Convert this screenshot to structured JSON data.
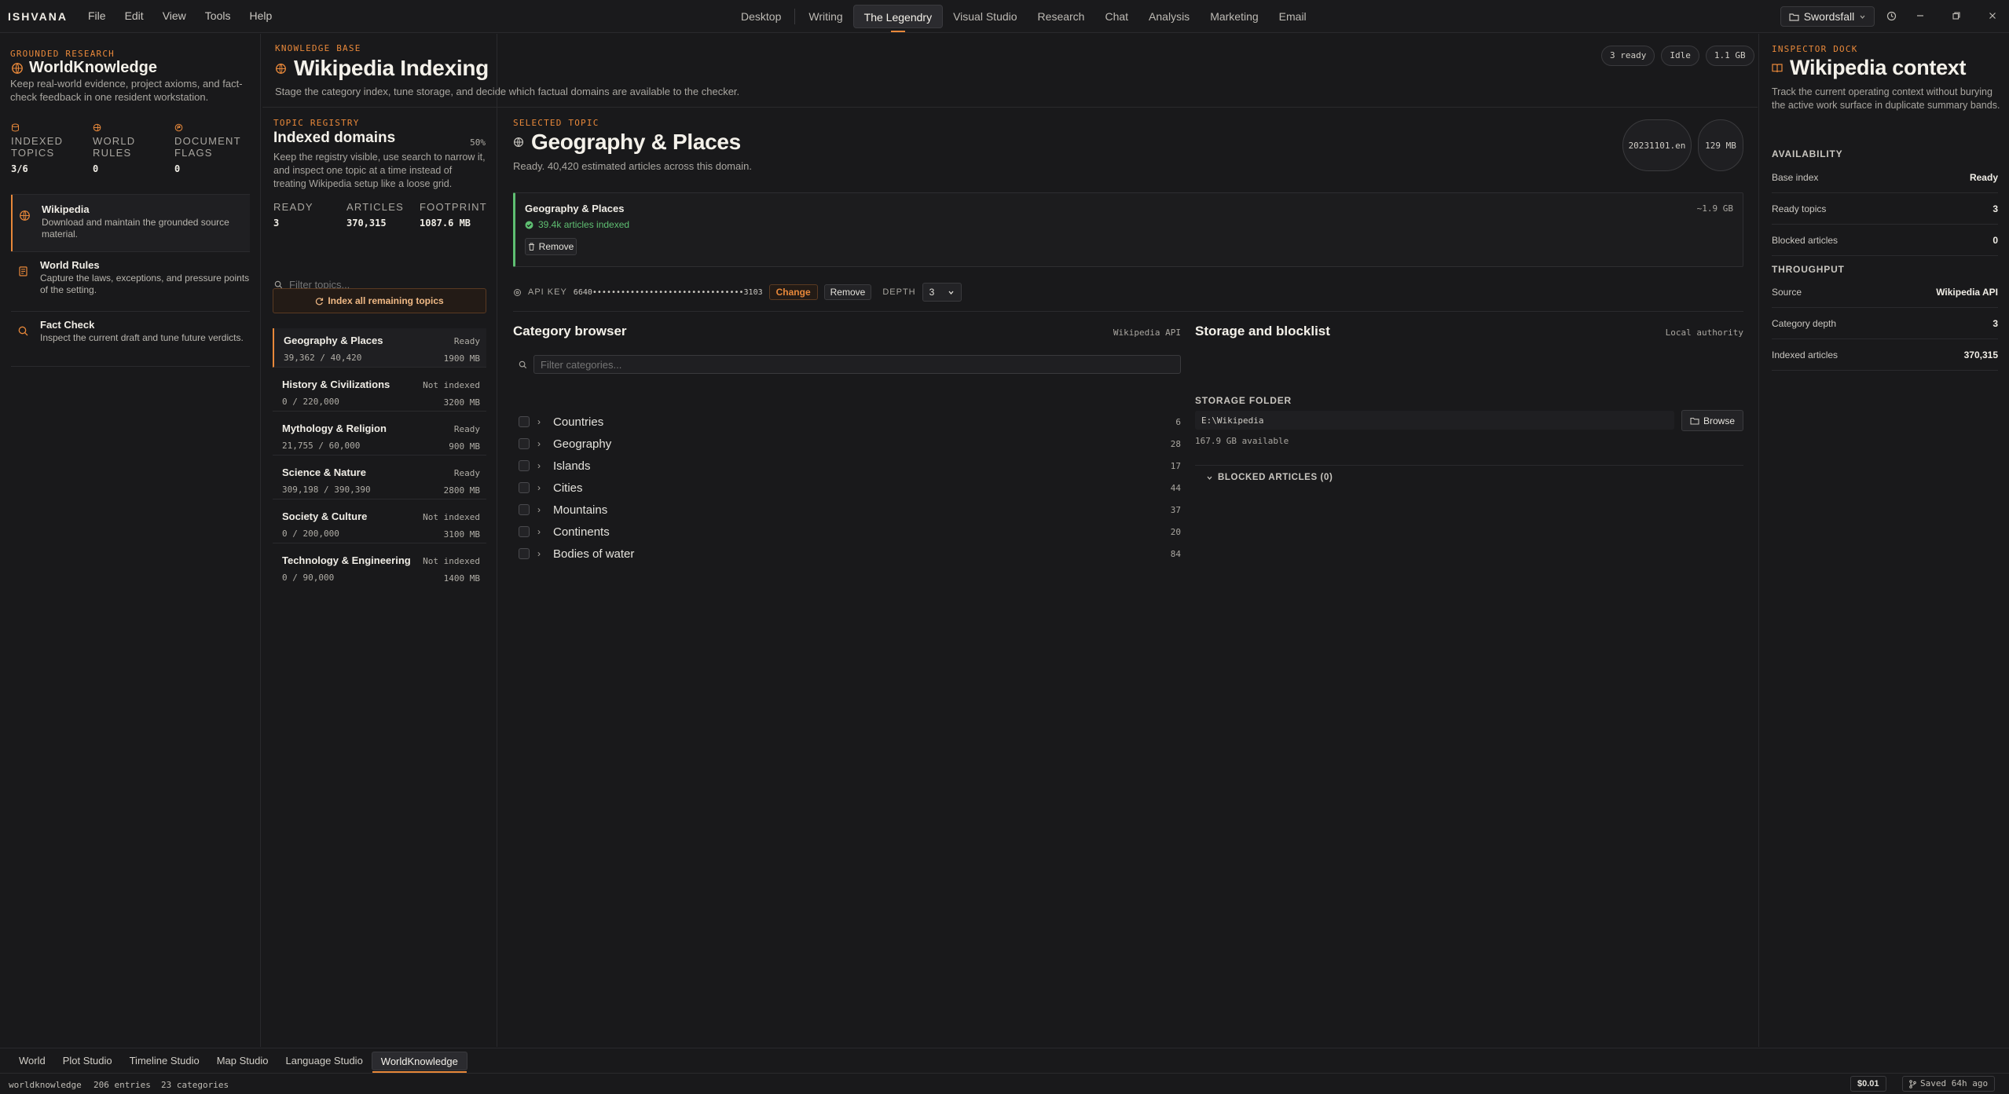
{
  "menubar": {
    "logo": "ISHVANA",
    "menus": [
      "File",
      "Edit",
      "View",
      "Tools",
      "Help"
    ],
    "tabs": [
      "Desktop",
      "Writing",
      "The Legendry",
      "Visual Studio",
      "Research",
      "Chat",
      "Analysis",
      "Marketing",
      "Email"
    ],
    "active_tab": "The Legendry",
    "project": "Swordsfall"
  },
  "left": {
    "eyebrow": "GROUNDED RESEARCH",
    "title": "WorldKnowledge",
    "description": "Keep real-world evidence, project axioms, and fact-check feedback in one resident workstation.",
    "stats": [
      {
        "label": "INDEXED TOPICS",
        "value": "3/6"
      },
      {
        "label": "WORLD RULES",
        "value": "0"
      },
      {
        "label": "DOCUMENT FLAGS",
        "value": "0"
      }
    ],
    "nav": [
      {
        "title": "Wikipedia",
        "desc": "Download and maintain the grounded source material."
      },
      {
        "title": "World Rules",
        "desc": "Capture the laws, exceptions, and pressure points of the setting."
      },
      {
        "title": "Fact Check",
        "desc": "Inspect the current draft and tune future verdicts."
      }
    ]
  },
  "header": {
    "eyebrow": "KNOWLEDGE BASE",
    "title": "Wikipedia Indexing",
    "subtitle": "Stage the category index, tune storage, and decide which factual domains are available to the checker.",
    "pills": [
      "3 ready",
      "Idle",
      "1.1 GB"
    ]
  },
  "registry": {
    "eyebrow": "TOPIC REGISTRY",
    "title": "Indexed domains",
    "percent": "50%",
    "description": "Keep the registry visible, use search to narrow it, and inspect one topic at a time instead of treating Wikipedia setup like a loose grid.",
    "stats": [
      {
        "label": "READY",
        "value": "3"
      },
      {
        "label": "ARTICLES",
        "value": "370,315"
      },
      {
        "label": "FOOTPRINT",
        "value": "1087.6 MB"
      }
    ],
    "filter_placeholder": "Filter topics...",
    "index_button": "Index all remaining topics",
    "topics": [
      {
        "name": "Geography & Places",
        "status": "Ready",
        "count": "39,362 / 40,420",
        "size": "1900 MB"
      },
      {
        "name": "History & Civilizations",
        "status": "Not indexed",
        "count": "0 / 220,000",
        "size": "3200 MB"
      },
      {
        "name": "Mythology & Religion",
        "status": "Ready",
        "count": "21,755 / 60,000",
        "size": "900 MB"
      },
      {
        "name": "Science & Nature",
        "status": "Ready",
        "count": "309,198 / 390,390",
        "size": "2800 MB"
      },
      {
        "name": "Society & Culture",
        "status": "Not indexed",
        "count": "0 / 200,000",
        "size": "3100 MB"
      },
      {
        "name": "Technology & Engineering",
        "status": "Not indexed",
        "count": "0 / 90,000",
        "size": "1400 MB"
      }
    ]
  },
  "selected": {
    "eyebrow": "SELECTED TOPIC",
    "title": "Geography & Places",
    "subtitle": "Ready. 40,420 estimated articles across this domain.",
    "badges": [
      "20231101.en",
      "129 MB"
    ],
    "card": {
      "title": "Geography & Places",
      "size": "~1.9 GB",
      "status": "39.4k articles indexed",
      "remove": "Remove"
    },
    "apikey": {
      "label": "API KEY",
      "value": "6640••••••••••••••••••••••••••••••••3103",
      "change": "Change",
      "remove": "Remove",
      "depth_label": "DEPTH",
      "depth_value": "3"
    }
  },
  "categories": {
    "title": "Category browser",
    "source": "Wikipedia API",
    "filter_placeholder": "Filter categories...",
    "items": [
      {
        "name": "Countries",
        "count": "6"
      },
      {
        "name": "Geography",
        "count": "28"
      },
      {
        "name": "Islands",
        "count": "17"
      },
      {
        "name": "Cities",
        "count": "44"
      },
      {
        "name": "Mountains",
        "count": "37"
      },
      {
        "name": "Continents",
        "count": "20"
      },
      {
        "name": "Bodies of water",
        "count": "84"
      }
    ]
  },
  "storage": {
    "title": "Storage and blocklist",
    "authority": "Local authority",
    "folder_label": "STORAGE FOLDER",
    "path": "E:\\Wikipedia",
    "browse": "Browse",
    "available": "167.9 GB available",
    "blocked_label": "BLOCKED ARTICLES (0)"
  },
  "dock": {
    "eyebrow": "INSPECTOR DOCK",
    "title": "Wikipedia context",
    "description": "Track the current operating context without burying the active work surface in duplicate summary bands.",
    "availability_label": "AVAILABILITY",
    "availability": [
      {
        "key": "Base index",
        "value": "Ready"
      },
      {
        "key": "Ready topics",
        "value": "3"
      },
      {
        "key": "Blocked articles",
        "value": "0"
      }
    ],
    "throughput_label": "THROUGHPUT",
    "throughput": [
      {
        "key": "Source",
        "value": "Wikipedia API"
      },
      {
        "key": "Category depth",
        "value": "3"
      },
      {
        "key": "Indexed articles",
        "value": "370,315"
      }
    ]
  },
  "bottom_tabs": [
    "World",
    "Plot Studio",
    "Timeline Studio",
    "Map Studio",
    "Language Studio",
    "WorldKnowledge"
  ],
  "bottom_active": "WorldKnowledge",
  "status": {
    "workspace": "worldknowledge",
    "entries": "206 entries",
    "categories": "23 categories",
    "cost": "$0.01",
    "saved": "Saved 64h ago"
  },
  "colors": {
    "accent": "#e8883a",
    "success": "#5fbf72",
    "background": "#19191b"
  }
}
